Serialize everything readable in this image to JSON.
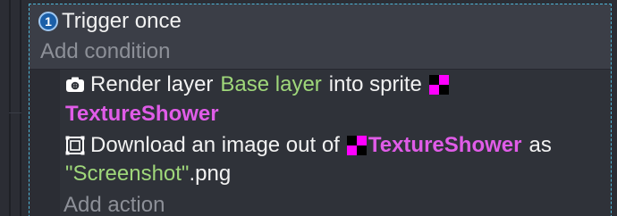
{
  "event": {
    "number_badge": "1",
    "condition_label": "Trigger once",
    "add_condition_label": "Add condition",
    "add_action_label": "Add action"
  },
  "actions": [
    {
      "icon": "camera-icon",
      "prefix": "Render layer",
      "layer": "Base layer",
      "middle": "into sprite",
      "object_icon": "sprite-checker-icon",
      "object": "TextureShower"
    },
    {
      "icon": "image-frame-icon",
      "prefix": "Download an image out of",
      "object_icon": "sprite-checker-icon",
      "object": "TextureShower",
      "middle": "as",
      "filename": "\"Screenshot\"",
      "suffix": ".png"
    }
  ],
  "colors": {
    "selection_border": "#4fb6d8",
    "parameter_green": "#9fd77a",
    "object_magenta": "#e05ce8",
    "badge_blue": "#1b5fa8"
  }
}
